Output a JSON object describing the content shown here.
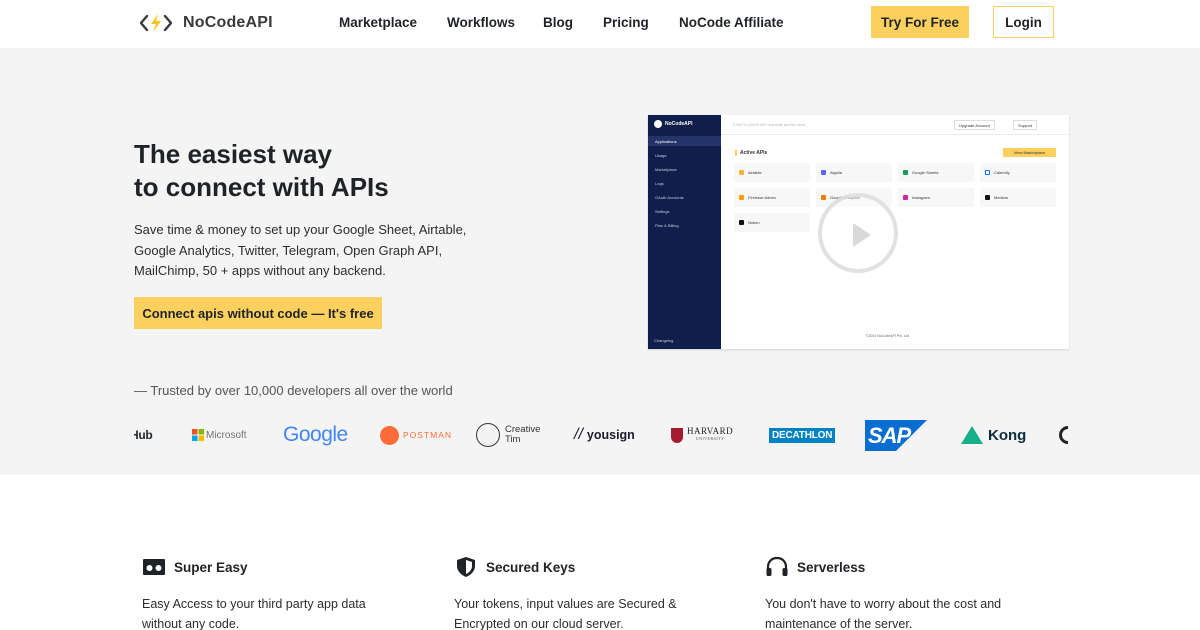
{
  "nav": {
    "brand": "NoCodeAPI",
    "links": [
      "Marketplace",
      "Workflows",
      "Blog",
      "Pricing",
      "NoCode Affiliate"
    ],
    "try_label": "Try For Free",
    "login_label": "Login"
  },
  "hero": {
    "headline_1": "The easiest way",
    "headline_2": "to connect with APIs",
    "subtitle": "Save time & money to set up your Google Sheet, Airtable, Google Analytics, Twitter, Telegram, Open Graph API, MailChimp, 50 + apps without any backend.",
    "cta_label": "Connect apis without code — It's free",
    "trusted": "— Trusted by over 10,000 developers all over the world"
  },
  "logos": {
    "items": [
      "Hub",
      "Microsoft",
      "Google",
      "POSTMAN",
      "Creative",
      "Tim",
      "yousign",
      "HARVARD",
      "UNIVERSITY",
      "DECATHLON",
      "SAP",
      "Kong"
    ]
  },
  "app_preview": {
    "brand": "NoCodeAPI",
    "sidebar": [
      "Applications",
      "Usage",
      "Marketplace",
      "Logs",
      "OAuth Accounts",
      "Settings",
      "Plan & Billing"
    ],
    "sidebar_footer": "Changelog",
    "topbar_text": "0.667% (4/600 API requests quota) used",
    "upgrade_label": "Upgrade Account",
    "support_label": "Support",
    "section_title": "Active APIs",
    "view_marketplace": "View Marketplace",
    "cards": [
      "Airtable",
      "Algolia",
      "Google Sheets",
      "Calendly",
      "Firebase Admin",
      "Google Analytics",
      "Instagram",
      "Medium",
      "Notion"
    ],
    "footer": "©2021 NoCodeAPI Pvt. Ltd."
  },
  "features": [
    {
      "title": "Super Easy",
      "desc": "Easy Access to your third party app data without any code."
    },
    {
      "title": "Secured Keys",
      "desc": "Your tokens, input values are Secured & Encrypted on our cloud server."
    },
    {
      "title": "Serverless",
      "desc": "You don't have to worry about the cost and maintenance of the server."
    }
  ],
  "colors": {
    "accent": "#fcd05f",
    "hero_bg": "#f4f4f4",
    "text": "#1f2328",
    "sidebar": "#0f1e4a"
  }
}
